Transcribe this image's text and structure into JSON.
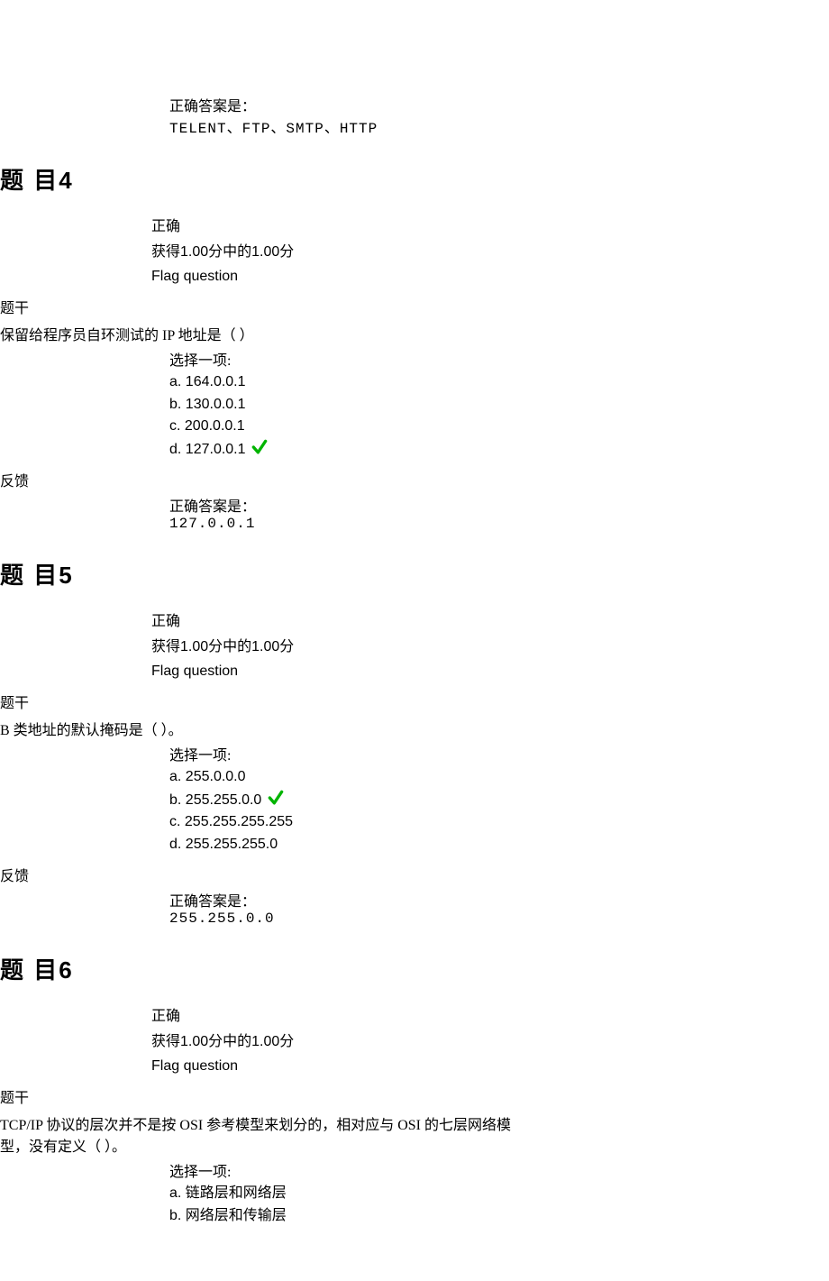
{
  "strings": {
    "correct_label": "正确答案是：",
    "status": "正确",
    "score": "获得1.00分中的1.00分",
    "flag": "Flag question",
    "tigan": "题干",
    "fankui": "反馈",
    "select": "选择一项:"
  },
  "intro": {
    "answer": "TELENT、FTP、SMTP、HTTP"
  },
  "questions": [
    {
      "title": "题 目4",
      "stem": "保留给程序员自环测试的 IP 地址是（  ）",
      "options": [
        {
          "label": "a.",
          "value": "164.0.0.1",
          "correct": false
        },
        {
          "label": "b.",
          "value": "130.0.0.1",
          "correct": false
        },
        {
          "label": "c.",
          "value": "200.0.0.1",
          "correct": false
        },
        {
          "label": "d.",
          "value": "127.0.0.1",
          "correct": true
        }
      ],
      "answer": "127.0.0.1"
    },
    {
      "title": "题 目5",
      "stem": "B 类地址的默认掩码是（  ）。",
      "options": [
        {
          "label": "a.",
          "value": "255.0.0.0",
          "correct": false
        },
        {
          "label": "b.",
          "value": "255.255.0.0",
          "correct": true
        },
        {
          "label": "c.",
          "value": "255.255.255.255",
          "correct": false
        },
        {
          "label": "d.",
          "value": "255.255.255.0",
          "correct": false
        }
      ],
      "answer": "255.255.0.0"
    },
    {
      "title": "题 目6",
      "stem": "TCP/IP 协议的层次并不是按 OSI 参考模型来划分的，相对应与 OSI 的七层网络模型，没有定义（  ）。",
      "options_partial": [
        {
          "label": "a.",
          "value": "链路层和网络层"
        },
        {
          "label": "b.",
          "value": "网络层和传输层"
        }
      ]
    }
  ]
}
